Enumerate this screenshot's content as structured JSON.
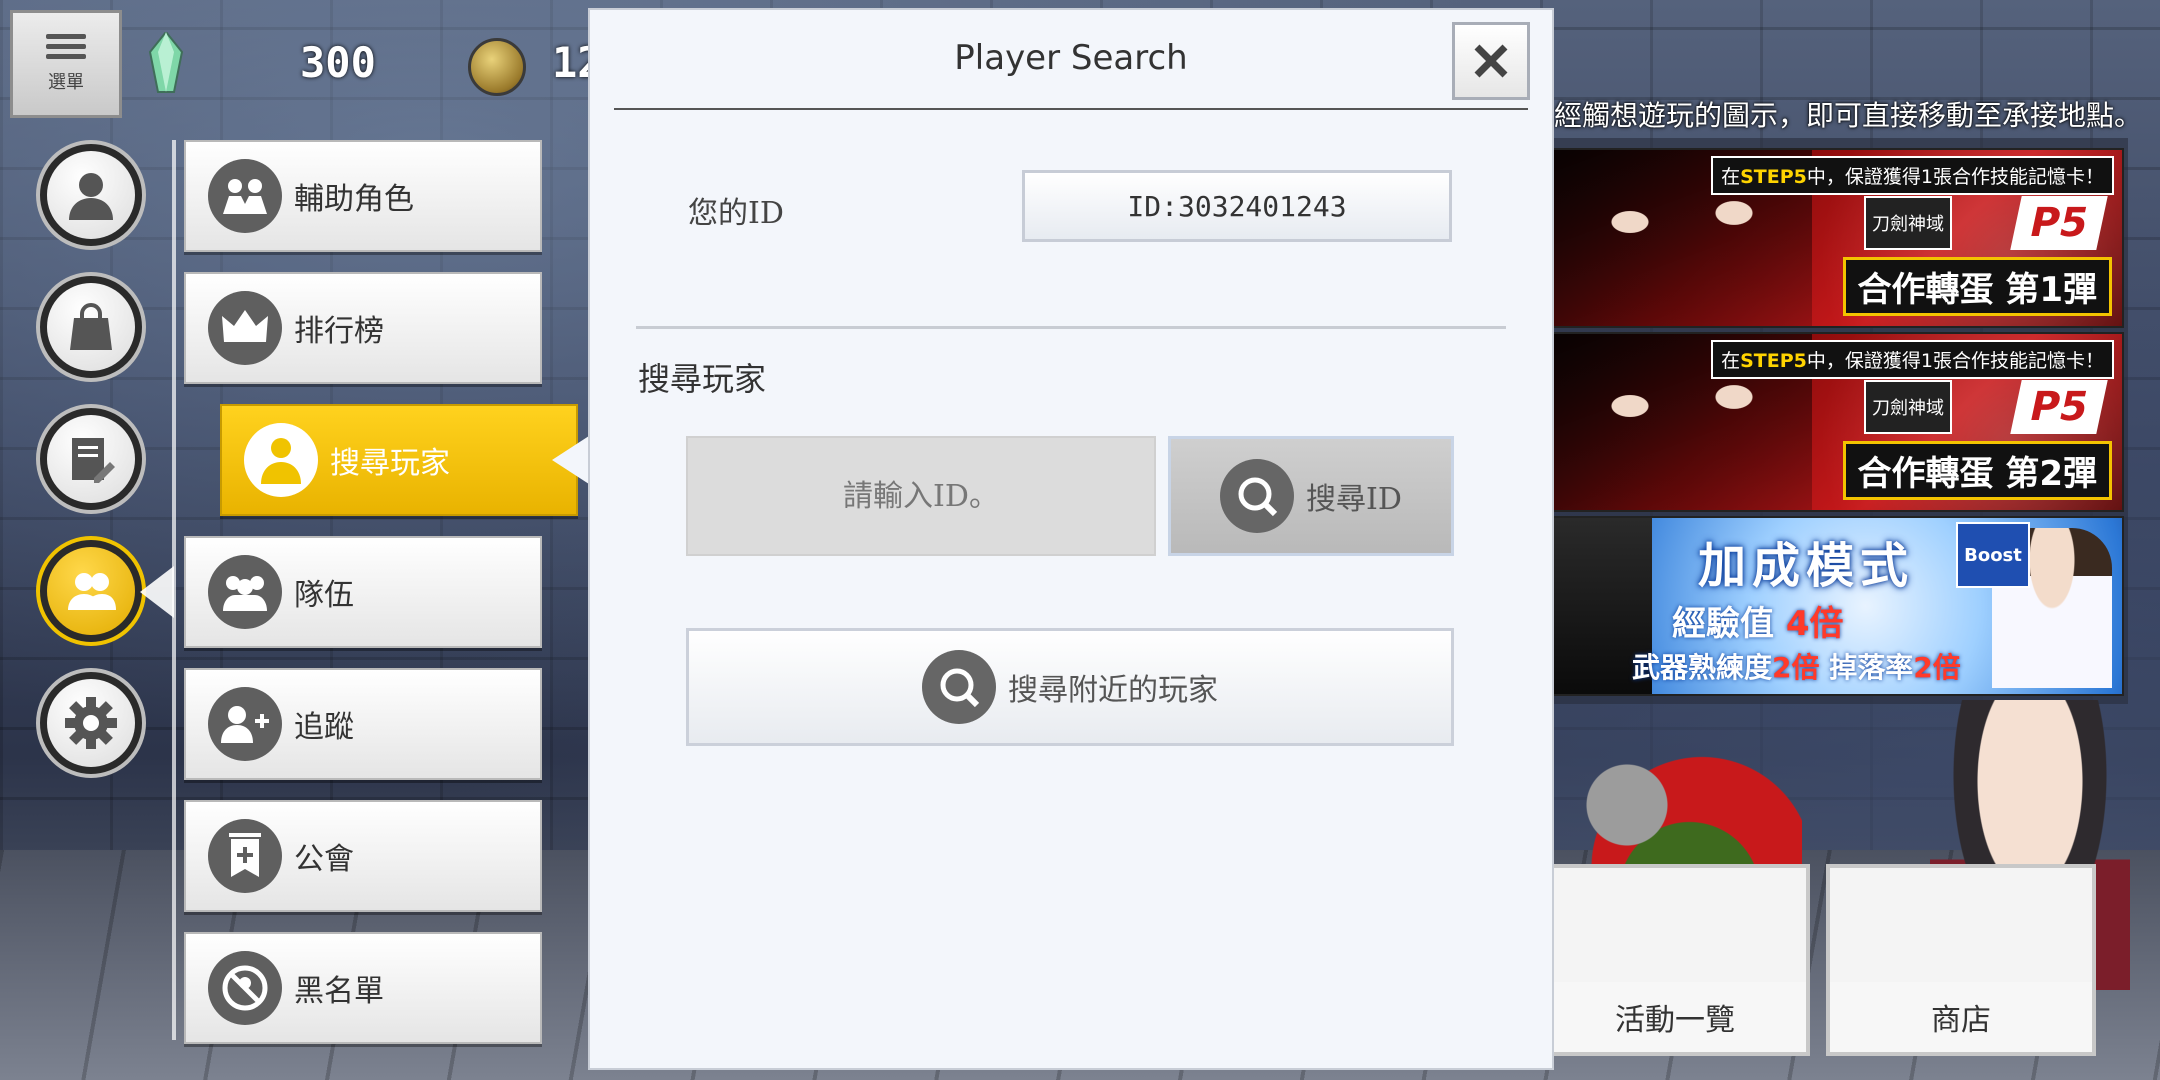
{
  "topbar": {
    "menu_label": "選單",
    "crystal_count": "300",
    "coin_count": "12"
  },
  "round_menu": [
    {
      "name": "profile",
      "icon": "person-icon"
    },
    {
      "name": "bag",
      "icon": "bag-icon"
    },
    {
      "name": "notes",
      "icon": "note-pencil-icon"
    },
    {
      "name": "friends",
      "icon": "people-icon",
      "active": true
    },
    {
      "name": "settings",
      "icon": "gear-icon"
    }
  ],
  "sub_menu": [
    {
      "label": "輔助角色",
      "icon": "handshake-icon"
    },
    {
      "label": "排行榜",
      "icon": "crown-icon"
    },
    {
      "label": "搜尋玩家",
      "icon": "person-search-icon",
      "active": true
    },
    {
      "label": "隊伍",
      "icon": "group-icon"
    },
    {
      "label": "追蹤",
      "icon": "follow-icon"
    },
    {
      "label": "公會",
      "icon": "guild-banner-icon"
    },
    {
      "label": "黑名單",
      "icon": "blocked-icon"
    }
  ],
  "dialog": {
    "title": "Player Search",
    "your_id_label": "您的ID",
    "your_id_value": "ID:3032401243",
    "section_title": "搜尋玩家",
    "id_input_placeholder": "請輸入ID。",
    "search_id_button": "搜尋ID",
    "search_nearby_button": "搜尋附近的玩家"
  },
  "right": {
    "hint": "經觸想遊玩的圖示，即可直接移動至承接地點。",
    "banners": [
      {
        "top_prefix": "在",
        "top_highlight": "STEP5",
        "top_text": "中，保證獲得1張合作技能記憶卡！",
        "logo": "刀劍神域",
        "p5": "P5",
        "main": "合作轉蛋 第1彈"
      },
      {
        "top_prefix": "在",
        "top_highlight": "STEP5",
        "top_text": "中，保證獲得1張合作技能記憶卡！",
        "logo": "刀劍神域",
        "p5": "P5",
        "main": "合作轉蛋 第2彈"
      }
    ],
    "boost_banner": {
      "title": "加成模式",
      "line1_prefix": "經驗值",
      "line1_value": "4倍",
      "line2_a": "武器熟練度",
      "line2_a_value": "2倍",
      "line2_b": "掉落率",
      "line2_b_value": "2倍",
      "badge": "Boost"
    },
    "tiles": [
      {
        "label": "活動一覽"
      },
      {
        "label": "商店"
      }
    ]
  },
  "colors": {
    "accent_yellow": "#f0c300",
    "dialog_bg": "#f3f6fb",
    "boost_red": "#ff3a2a"
  }
}
